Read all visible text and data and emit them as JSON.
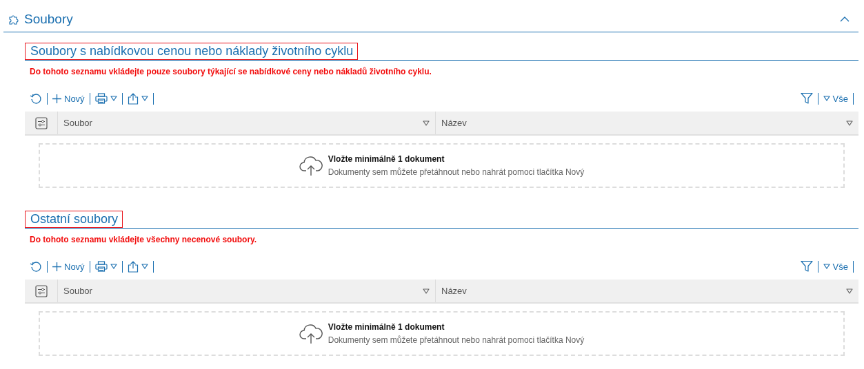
{
  "panel": {
    "title": "Soubory",
    "expanded": true
  },
  "sections": [
    {
      "title": "Soubory s nabídkovou cenou nebo náklady životního cyklu",
      "warning": "Do tohoto seznamu vkládejte pouze soubory týkající se nabídkové ceny nebo nákladů životního cyklu.",
      "toolbar": {
        "new_label": "Nový",
        "filter_label": "Vše"
      },
      "columns": [
        "Soubor",
        "Název"
      ],
      "dropzone": {
        "title": "Vložte minimálně 1 dokument",
        "hint": "Dokumenty sem můžete přetáhnout nebo nahrát pomoci tlačítka Nový"
      }
    },
    {
      "title": "Ostatní soubory",
      "warning": "Do tohoto seznamu vkládejte všechny necenové soubory.",
      "toolbar": {
        "new_label": "Nový",
        "filter_label": "Vše"
      },
      "columns": [
        "Soubor",
        "Název"
      ],
      "dropzone": {
        "title": "Vložte minimálně 1 dokument",
        "hint": "Dokumenty sem můžete přetáhnout nebo nahrát pomoci tlačítka Nový"
      }
    }
  ]
}
